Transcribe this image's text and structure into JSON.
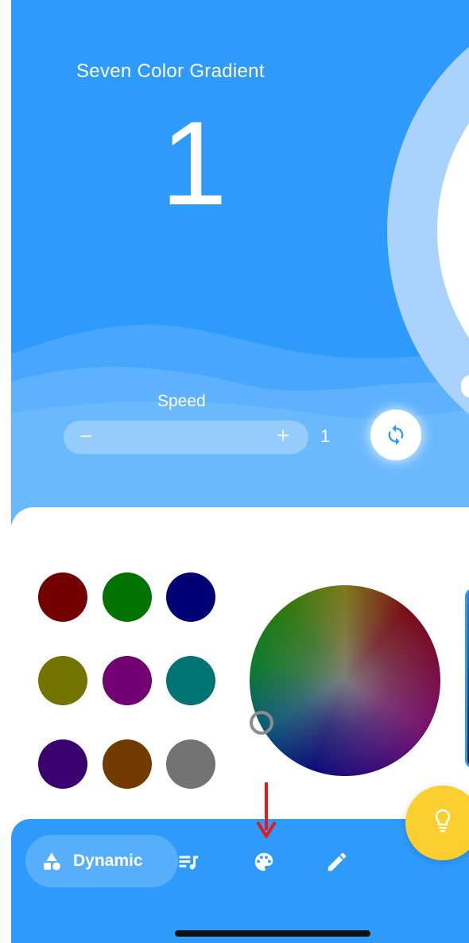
{
  "mode": {
    "title": "Seven Color Gradient",
    "number": "1"
  },
  "speed": {
    "label": "Speed",
    "minus": "−",
    "plus": "+",
    "value": "1"
  },
  "swatches": [
    "#730000",
    "#007300",
    "#000073",
    "#737300",
    "#730073",
    "#007373",
    "#3a006e",
    "#733a00",
    "#737373"
  ],
  "bottom_nav": {
    "tabs": [
      {
        "label": "Dynamic",
        "icon": "shapes-icon",
        "active": true
      },
      {
        "label": "",
        "icon": "music-list-icon",
        "active": false
      },
      {
        "label": "",
        "icon": "palette-icon",
        "active": false
      },
      {
        "label": "",
        "icon": "pencil-icon",
        "active": false
      }
    ]
  },
  "colors": {
    "primary": "#2e9bfb",
    "ring": "#a9d3fd",
    "bulb": "#fbcf2e",
    "annotation": "#e8191b"
  },
  "icons": {
    "repeat": "repeat-icon",
    "bulb": "lightbulb-icon",
    "annotation": "red-arrow"
  }
}
